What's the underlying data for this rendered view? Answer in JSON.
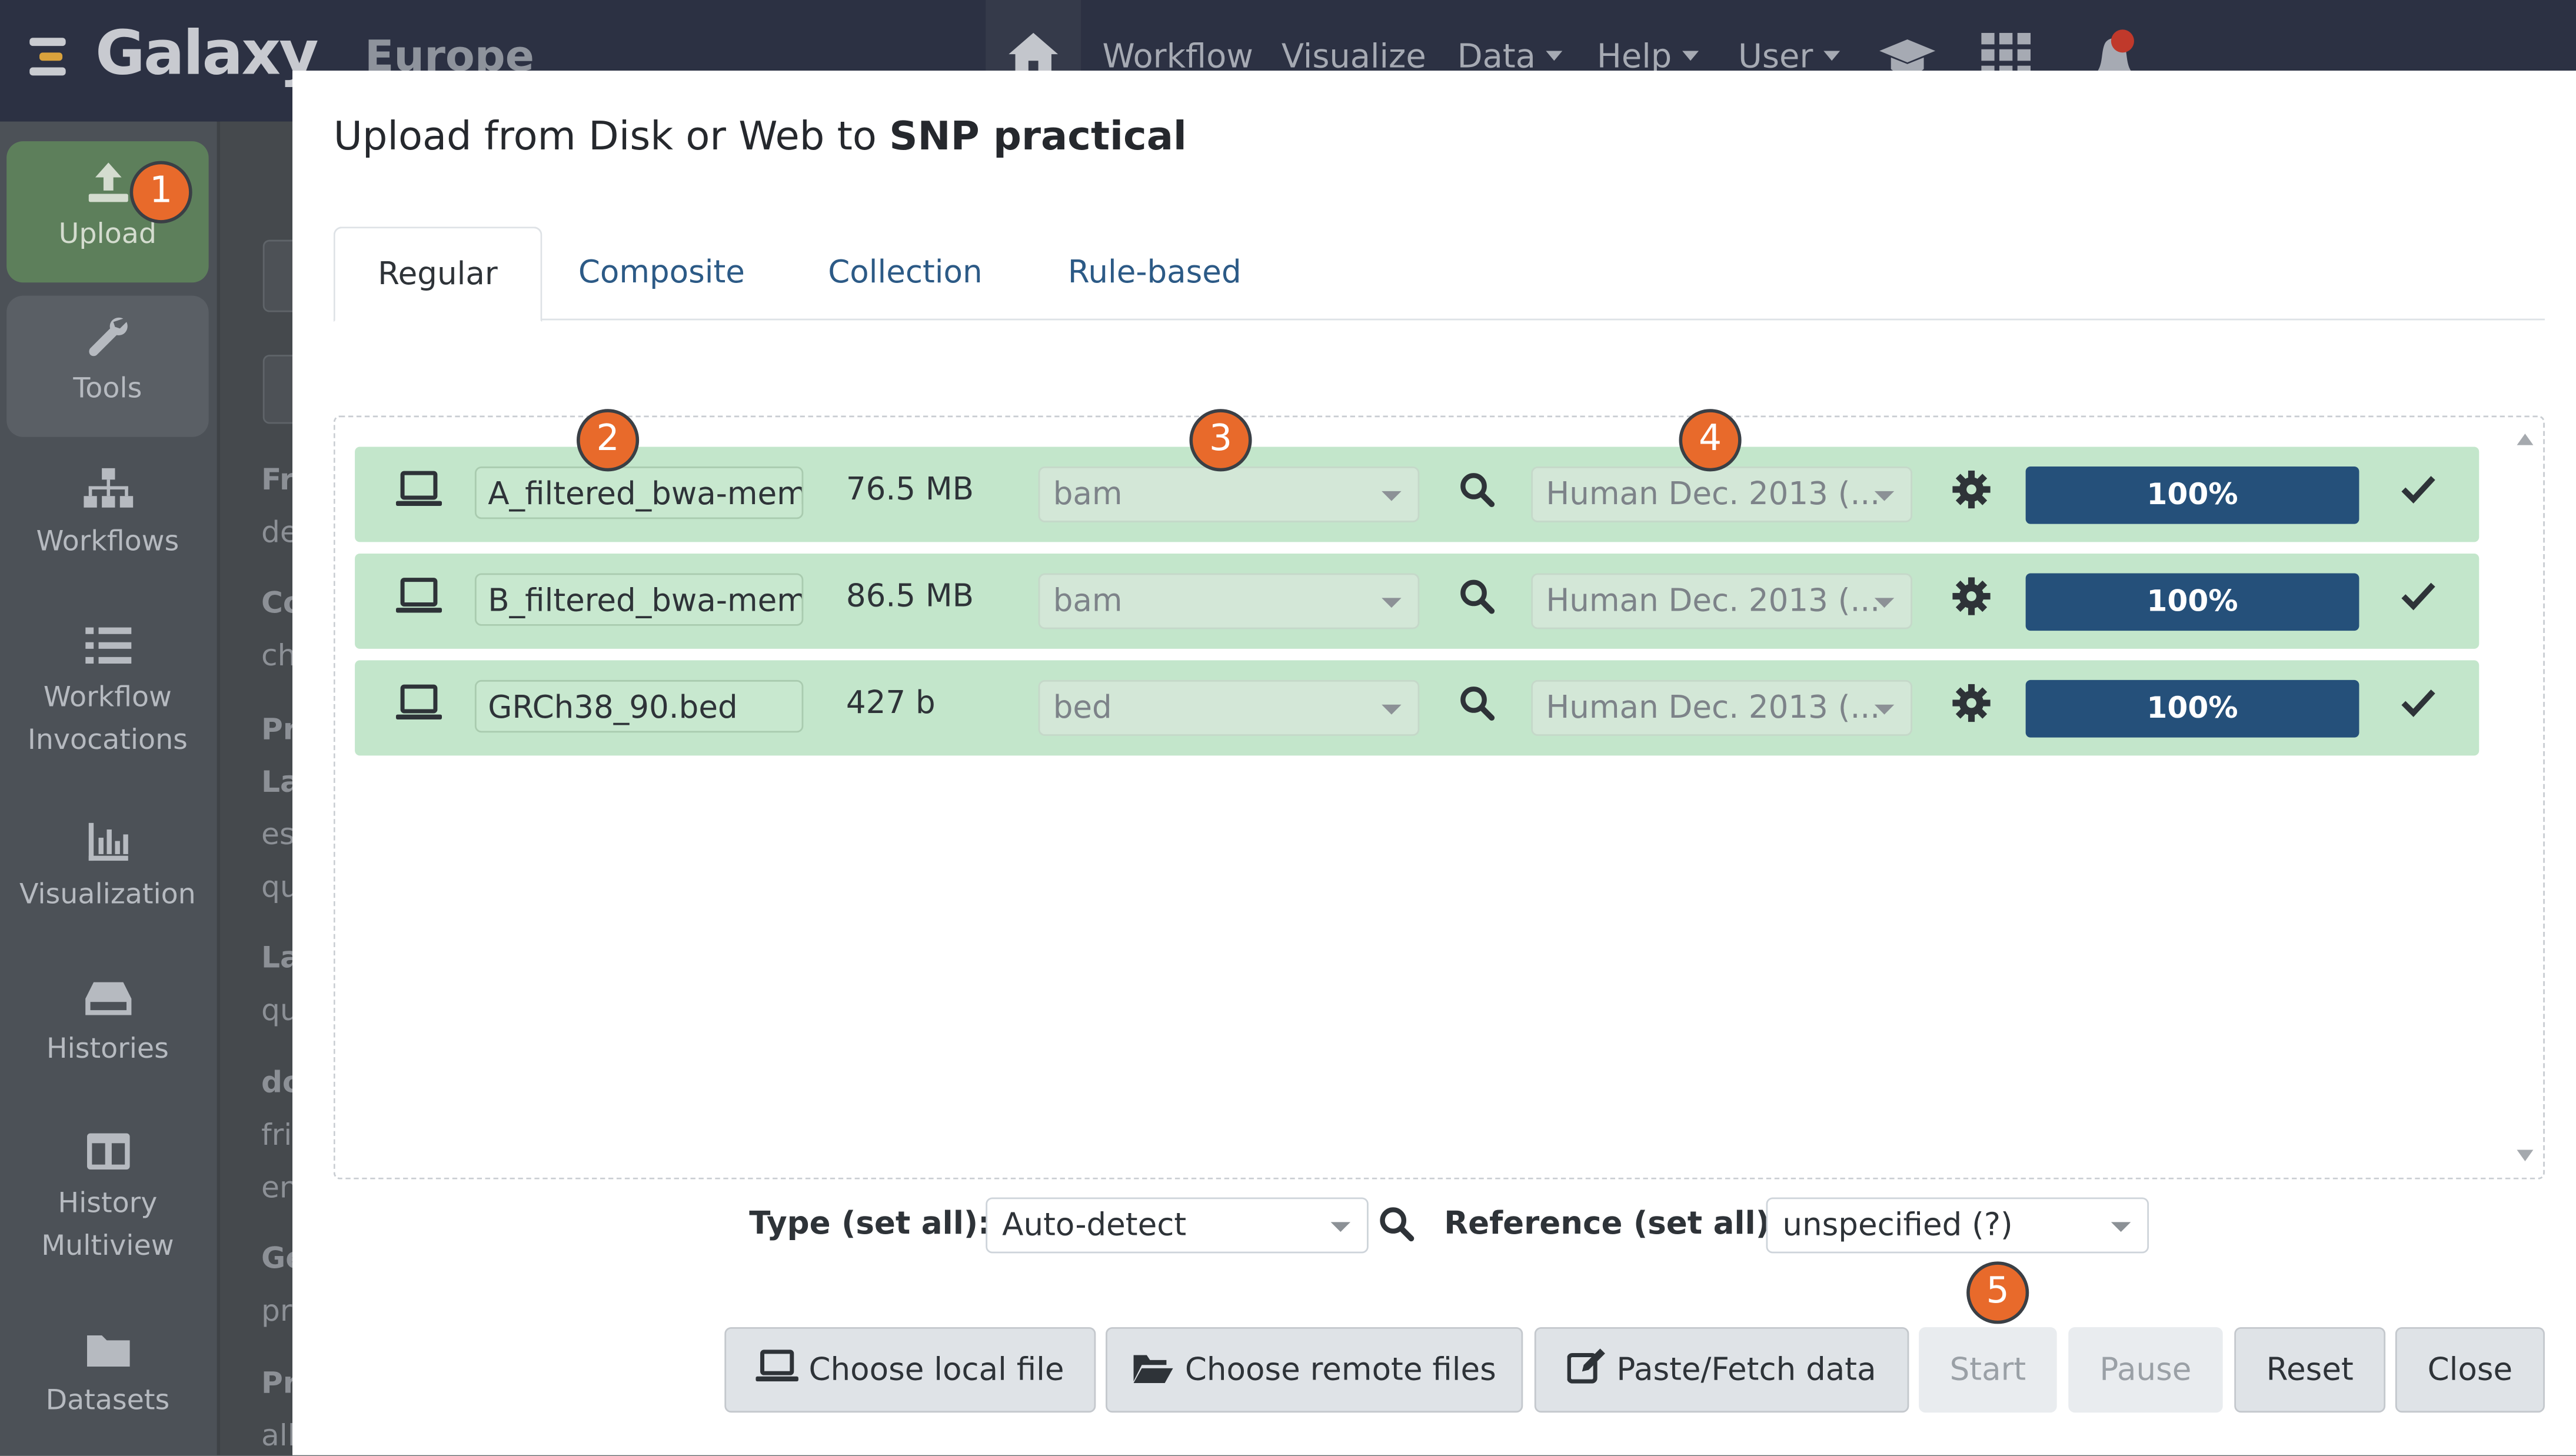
{
  "app": {
    "brand": "Galaxy",
    "brand_subtitle": "Europe"
  },
  "topnav": {
    "items": [
      {
        "label": "Workflow"
      },
      {
        "label": "Visualize"
      },
      {
        "label": "Data",
        "dropdown": true
      },
      {
        "label": "Help",
        "dropdown": true
      },
      {
        "label": "User",
        "dropdown": true
      }
    ],
    "icons": [
      "home-icon",
      "graduation-cap-icon",
      "apps-grid-icon",
      "notification-bell-icon"
    ]
  },
  "sidebar": {
    "items": [
      {
        "label": "Upload",
        "icon": "upload-icon",
        "active": true
      },
      {
        "label": "Tools",
        "icon": "wrench-icon"
      },
      {
        "label": "Workflows",
        "icon": "sitemap-icon"
      },
      {
        "label": "Workflow Invocations",
        "icon": "list-icon"
      },
      {
        "label": "Visualization",
        "icon": "bar-chart-icon"
      },
      {
        "label": "Histories",
        "icon": "hdd-icon"
      },
      {
        "label": "History Multiview",
        "icon": "columns-icon"
      },
      {
        "label": "Datasets",
        "icon": "folder-icon"
      }
    ]
  },
  "background_panel_fragments": [
    "Fr",
    "de",
    "Co",
    "ch",
    "Pr",
    "La",
    "es",
    "qu",
    "La",
    "qu",
    "do",
    "fri",
    "en",
    "Ge",
    "pr",
    "Pr",
    "all"
  ],
  "modal": {
    "title_prefix": "Upload from Disk or Web to",
    "title_history": "SNP practical",
    "tabs": [
      {
        "label": "Regular",
        "active": true
      },
      {
        "label": "Composite"
      },
      {
        "label": "Collection"
      },
      {
        "label": "Rule-based"
      }
    ],
    "files": [
      {
        "name": "A_filtered_bwa-mem",
        "size": "76.5 MB",
        "type": "bam",
        "reference": "Human Dec. 2013 (...",
        "progress": "100%",
        "progress_value": 100
      },
      {
        "name": "B_filtered_bwa-mem",
        "size": "86.5 MB",
        "type": "bam",
        "reference": "Human Dec. 2013 (...",
        "progress": "100%",
        "progress_value": 100
      },
      {
        "name": "GRCh38_90.bed",
        "size": "427 b",
        "type": "bed",
        "reference": "Human Dec. 2013 (...",
        "progress": "100%",
        "progress_value": 100
      }
    ],
    "set_all": {
      "type_label": "Type (set all):",
      "type_value": "Auto-detect",
      "reference_label": "Reference (set all):",
      "reference_value": "unspecified (?)"
    },
    "buttons": {
      "choose_local": "Choose local file",
      "choose_remote": "Choose remote files",
      "paste_fetch": "Paste/Fetch data",
      "start": "Start",
      "pause": "Pause",
      "reset": "Reset",
      "close": "Close"
    }
  },
  "annotations": [
    "1",
    "2",
    "3",
    "4",
    "5"
  ],
  "colors": {
    "row_success": "#c3e6cb",
    "progress_bar": "#25507a",
    "badge": "#e86a2b",
    "nav": "#2c3143"
  }
}
